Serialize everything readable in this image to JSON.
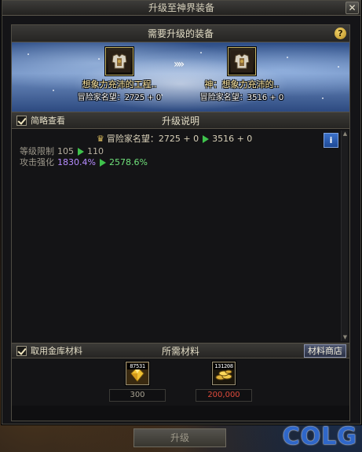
{
  "window": {
    "title": "升级至神界装备",
    "close_glyph": "✕"
  },
  "required": {
    "title": "需要升级的装备",
    "help_glyph": "?",
    "from": {
      "name": "想象力充沛的工程..",
      "fame": "冒险家名望：2725 + 0"
    },
    "arrows": "»»",
    "to": {
      "name": "神：想象力充沛的..",
      "fame": "冒险家名望：3516 + 0"
    }
  },
  "description": {
    "checkbox_label": "简略查看",
    "title": "升级说明",
    "info_glyph": "i",
    "fame": {
      "label": "冒险家名望：",
      "old": "2725 + 0",
      "new": "3516 + 0"
    },
    "stats": [
      {
        "label": "等级限制",
        "old": "105",
        "new": "110"
      },
      {
        "label": "攻击强化",
        "old": "1830.4%",
        "new": "2578.6%"
      }
    ]
  },
  "materials": {
    "checkbox_label": "取用金库材料",
    "title": "所需材料",
    "shop_label": "材料商店",
    "items": [
      {
        "icon": "gem-material-icon",
        "count": "87531",
        "required": "300"
      },
      {
        "icon": "gold-coins-icon",
        "count": "131208",
        "required": "200,000"
      }
    ]
  },
  "upgrade_label": "升级",
  "watermark": "COLG",
  "colors": {
    "positive": "#3fc24c",
    "purple": "#b68cff",
    "insufficient": "#e04a3c",
    "accent": "#2f67c9"
  }
}
